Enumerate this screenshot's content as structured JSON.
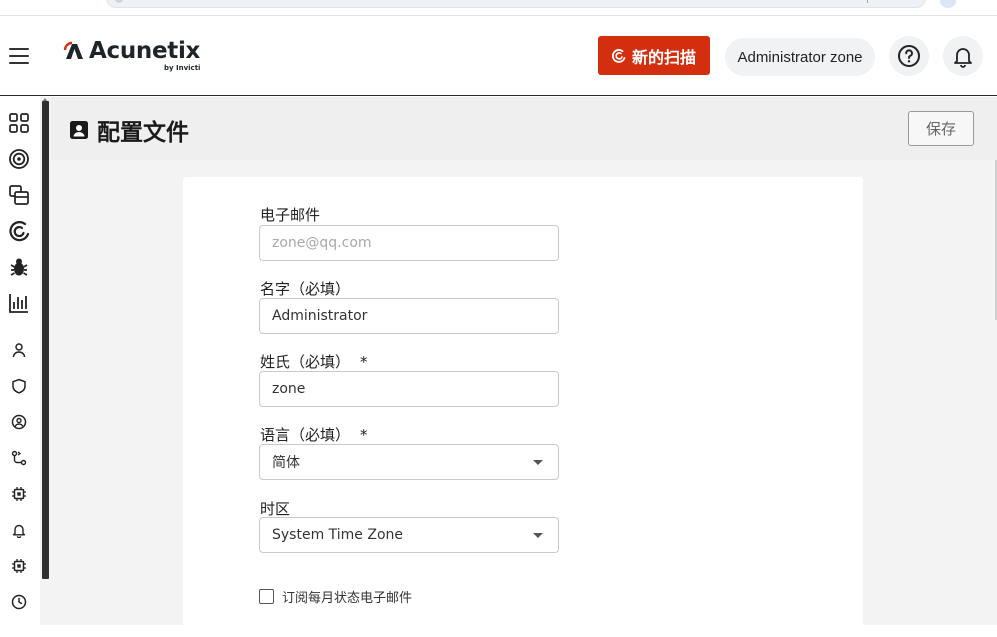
{
  "header": {
    "logo_text": "Acunetix",
    "logo_sub": "by Invicti",
    "new_scan_label": "新的扫描",
    "user_name": "Administrator zone"
  },
  "sidebar": {
    "items": [
      "dashboard-icon",
      "targets-icon",
      "scans-icon",
      "acunetix-scan-icon",
      "vulnerabilities-icon",
      "reports-icon",
      "users-icon",
      "shield-icon",
      "roles-icon",
      "integrations-icon",
      "scan-engine-icon",
      "notifications-icon",
      "workers-icon",
      "history-icon"
    ]
  },
  "page": {
    "title": "配置文件",
    "save_label": "保存"
  },
  "form": {
    "email_label": "电子邮件",
    "email_placeholder": "zone@qq.com",
    "first_name_label": "名字（必填）",
    "first_name_value": "Administrator",
    "last_name_label": "姓氏（必填）",
    "last_name_value": "zone",
    "language_label": "语言（必填）",
    "language_value": "简体",
    "timezone_label": "时区",
    "timezone_value": "System Time Zone",
    "required_marker": "*",
    "subscribe_label": "订阅每月状态电子邮件",
    "subscribe_checked": false
  },
  "colors": {
    "brand_red": "#d32f0f",
    "header_bg": "#ffffff",
    "page_bg": "#f3f3f4"
  }
}
